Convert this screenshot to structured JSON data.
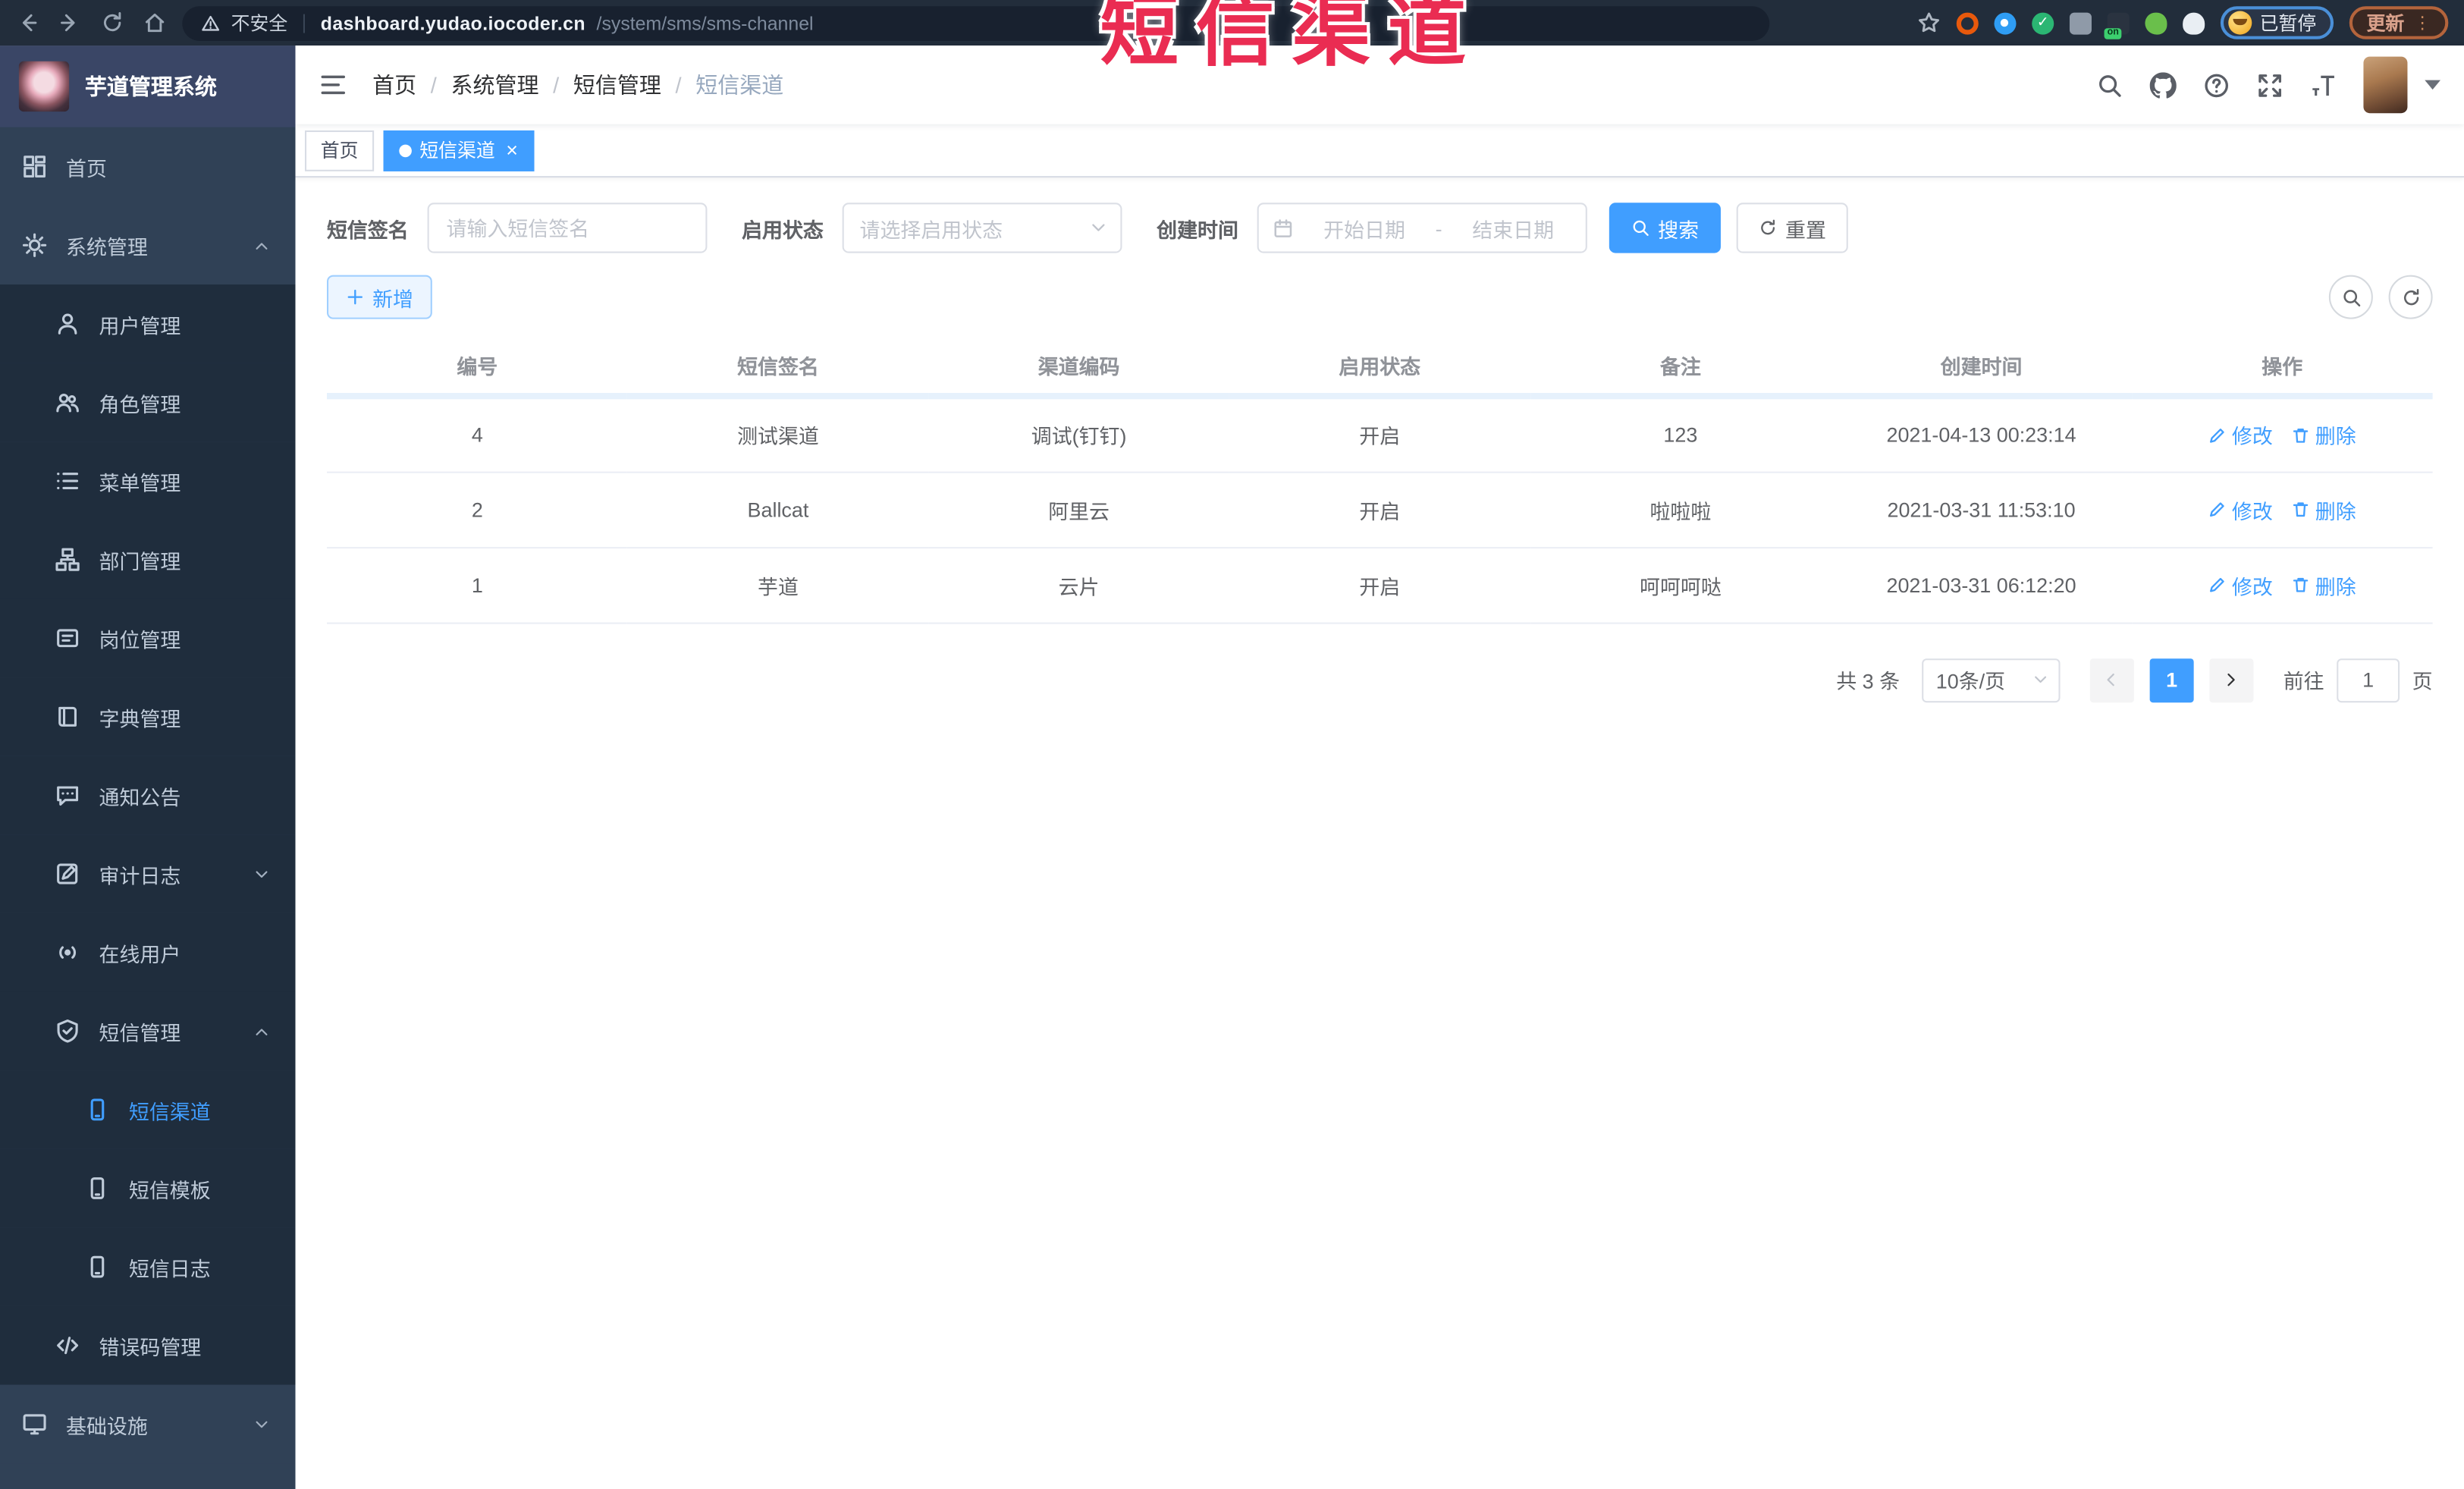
{
  "colors": {
    "accent": "#409eff",
    "overlay_red": "#ea2c52",
    "sidebar_bg": "#304156",
    "submenu_bg": "#1f2d3d"
  },
  "overlay": {
    "text": "短信渠道"
  },
  "browser": {
    "security_label": "不安全",
    "url_host": "dashboard.yudao.iocoder.cn",
    "url_path": "/system/sms/sms-channel",
    "profile_badge": "已暂停",
    "update_label": "更新",
    "menu_dots": "⋮",
    "extension_icons": [
      {
        "name": "bookmark-star-icon",
        "type": "star"
      },
      {
        "name": "extension-orange-ring-icon",
        "type": "ring",
        "color": "#e8590c"
      },
      {
        "name": "extension-blue-pin-icon",
        "type": "dot",
        "color": "#2f9df4"
      },
      {
        "name": "extension-green-check-icon",
        "type": "check",
        "color": "#2bb673",
        "glyph": "✓"
      },
      {
        "name": "extension-tabs-icon",
        "type": "tabs",
        "color": "#8f9aa8"
      },
      {
        "name": "extension-recorder-icon",
        "type": "rec",
        "color": "#2a3340"
      },
      {
        "name": "extension-sprout-icon",
        "type": "sprout",
        "color": "#6abf4b"
      },
      {
        "name": "extension-ghost-icon",
        "type": "ghost",
        "color": "#e9eef3"
      }
    ]
  },
  "sidebar": {
    "logo_title": "芋道管理系统",
    "items": [
      {
        "label": "首页",
        "icon": "dashboard",
        "level": 1
      },
      {
        "label": "系统管理",
        "icon": "gear",
        "level": 1,
        "arrow": "up"
      },
      {
        "label": "用户管理",
        "icon": "user",
        "level": 2
      },
      {
        "label": "角色管理",
        "icon": "users",
        "level": 2
      },
      {
        "label": "菜单管理",
        "icon": "list",
        "level": 2
      },
      {
        "label": "部门管理",
        "icon": "tree",
        "level": 2
      },
      {
        "label": "岗位管理",
        "icon": "badge",
        "level": 2
      },
      {
        "label": "字典管理",
        "icon": "book",
        "level": 2
      },
      {
        "label": "通知公告",
        "icon": "chat",
        "level": 2
      },
      {
        "label": "审计日志",
        "icon": "editlog",
        "level": 2,
        "arrow": "down"
      },
      {
        "label": "在线用户",
        "icon": "signal",
        "level": 2
      },
      {
        "label": "短信管理",
        "icon": "shieldmsg",
        "level": 2,
        "arrow": "up"
      },
      {
        "label": "短信渠道",
        "icon": "phone",
        "level": 3,
        "active": true
      },
      {
        "label": "短信模板",
        "icon": "phone",
        "level": 3
      },
      {
        "label": "短信日志",
        "icon": "phone",
        "level": 3
      },
      {
        "label": "错误码管理",
        "icon": "code",
        "level": 2
      },
      {
        "label": "基础设施",
        "icon": "monitor",
        "level": 1,
        "arrow": "down"
      }
    ]
  },
  "header": {
    "breadcrumb": [
      "首页",
      "系统管理",
      "短信管理",
      "短信渠道"
    ]
  },
  "tabs": [
    {
      "label": "首页",
      "active": false,
      "closable": false
    },
    {
      "label": "短信渠道",
      "active": true,
      "closable": true
    }
  ],
  "filters": {
    "sign_label": "短信签名",
    "sign_placeholder": "请输入短信签名",
    "status_label": "启用状态",
    "status_placeholder": "请选择启用状态",
    "time_label": "创建时间",
    "start_placeholder": "开始日期",
    "range_separator": "-",
    "end_placeholder": "结束日期",
    "search_label": "搜索",
    "reset_label": "重置"
  },
  "toolbar": {
    "add_label": "新增"
  },
  "table": {
    "columns": [
      "编号",
      "短信签名",
      "渠道编码",
      "启用状态",
      "备注",
      "创建时间",
      "操作"
    ],
    "rows": [
      [
        "4",
        "测试渠道",
        "调试(钉钉)",
        "开启",
        "123",
        "2021-04-13 00:23:14"
      ],
      [
        "2",
        "Ballcat",
        "阿里云",
        "开启",
        "啦啦啦",
        "2021-03-31 11:53:10"
      ],
      [
        "1",
        "芋道",
        "云片",
        "开启",
        "呵呵呵哒",
        "2021-03-31 06:12:20"
      ]
    ],
    "edit_label": "修改",
    "delete_label": "删除"
  },
  "pagination": {
    "total_text": "共 3 条",
    "page_size": "10条/页",
    "current_page": "1",
    "goto_label": "前往",
    "goto_value": "1",
    "page_unit": "页"
  }
}
